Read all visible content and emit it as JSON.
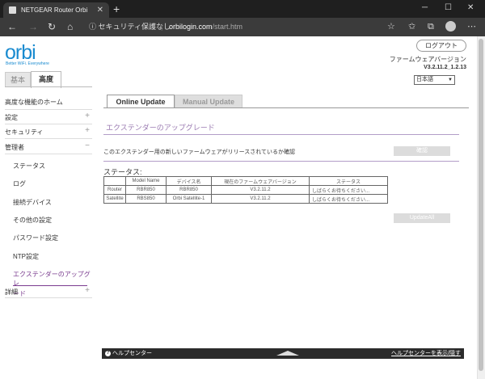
{
  "browser": {
    "tab_title": "NETGEAR Router Orbi",
    "tab_close": "✕",
    "new_tab": "+",
    "window": {
      "minimize": "─",
      "maximize": "☐",
      "close": "✕"
    },
    "security_text": "ⓘ セキュリティ保護なし",
    "url_domain": "orbilogin.com",
    "url_path": "/start.htm"
  },
  "header": {
    "logo_text": "orbi",
    "tagline": "Better WiFi. Everywhere",
    "logout_label": "ログアウト",
    "firmware_label": "ファームウェアバージョン",
    "firmware_version": "V3.2.11.2_1.2.13",
    "language": "日本語"
  },
  "main_tabs": {
    "basic": "基本",
    "advanced": "高度"
  },
  "sidebar": {
    "advanced_home": "高度な機能のホーム",
    "setup": "設定",
    "security": "セキュリティ",
    "admin": "管理者",
    "status": "ステータス",
    "logs": "ログ",
    "attached_devices": "接続デバイス",
    "other_settings": "その他の設定",
    "password": "パスワード設定",
    "ntp": "NTP設定",
    "extender_upgrade_1": "エクステンダーのアップグレ",
    "extender_upgrade_2": "ード",
    "advanced_setup": "詳細",
    "expand": "+",
    "collapse": "−"
  },
  "content": {
    "tab_online": "Online Update",
    "tab_manual": "Manual Update",
    "section_title": "エクステンダーのアップグレード",
    "check_text": "このエクステンダー用の新しいファームウェアがリリースされているか確認",
    "check_button": "確認",
    "status_label": "ステータス:",
    "update_all_button": "UpdateAll",
    "table": {
      "headers": [
        "",
        "Model Name",
        "デバイス名",
        "現在のファームウェアバージョン",
        "ステータス"
      ],
      "rows": [
        [
          "Router",
          "RBR850",
          "RBR850",
          "V3.2.11.2",
          "しばらくお待ちください..."
        ],
        [
          "Satellite",
          "RBS850",
          "Orbi Satellite-1",
          "V3.2.11.2",
          "しばらくお待ちください..."
        ]
      ]
    }
  },
  "help": {
    "left": "ヘルプセンター",
    "right": "ヘルプセンターを表示/隠す",
    "icon": "?"
  }
}
